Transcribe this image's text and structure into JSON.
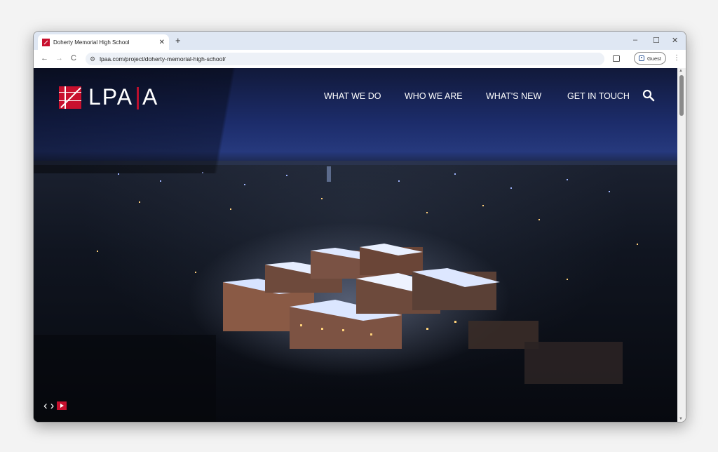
{
  "browser": {
    "tab": {
      "title": "Doherty Memorial High School",
      "favicon": "lpa-favicon-icon"
    },
    "new_tab": "+",
    "window_controls": {
      "minimize": "–",
      "maximize": "☐",
      "close": "✕"
    },
    "nav": {
      "back": "←",
      "forward": "→",
      "reload": "C"
    },
    "url": "lpaa.com/project/doherty-memorial-high-school/",
    "profile": {
      "label": "Guest"
    }
  },
  "site": {
    "logo": {
      "left": "LPA",
      "right": "A",
      "accent": "#c8102e"
    },
    "nav": [
      {
        "label": "WHAT WE DO"
      },
      {
        "label": "WHO WE ARE"
      },
      {
        "label": "WHAT'S NEW"
      },
      {
        "label": "GET IN TOUCH"
      }
    ],
    "slider": {
      "prev": "‹",
      "next": "›"
    }
  }
}
